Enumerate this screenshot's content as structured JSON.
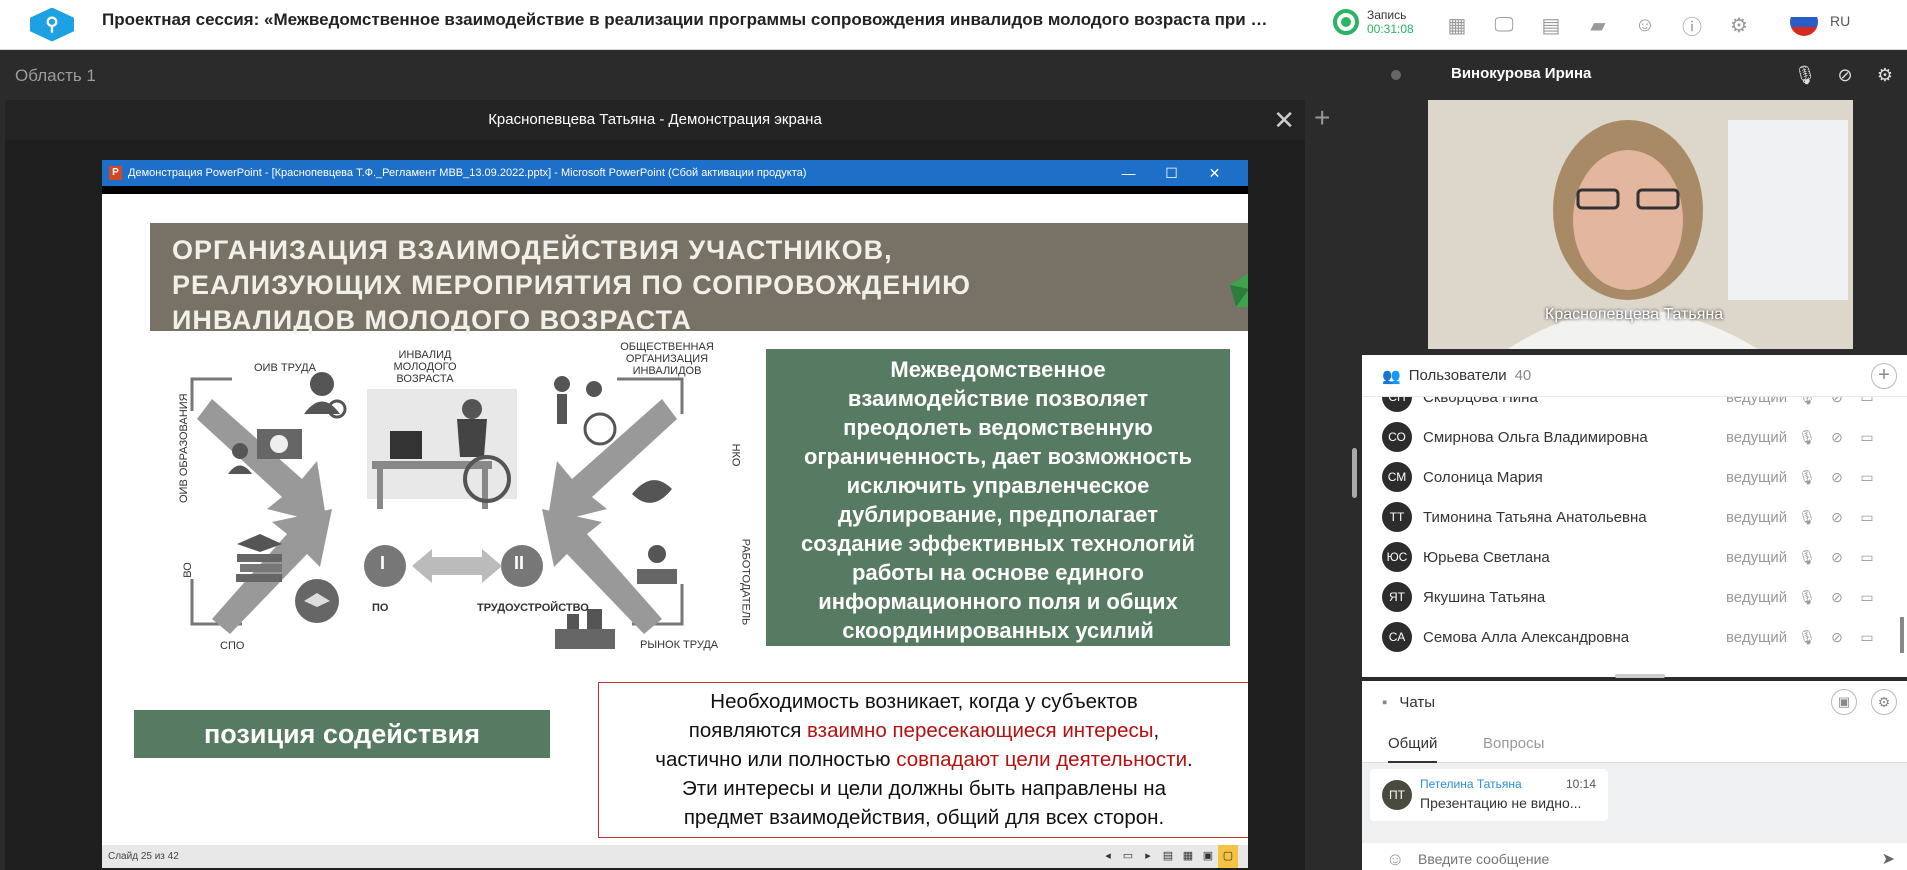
{
  "header": {
    "logo_glyph": "⚲",
    "title": "Проектная сессия: «Межведомственное взаимодействие в реализации программы сопровождения инвалидов молодого возраста при получ...",
    "record_label": "Запись",
    "record_time": "00:31:08",
    "icons": [
      "grid-icon",
      "monitor-icon",
      "document-icon",
      "folder-icon",
      "users-icon",
      "info-icon",
      "gear-icon"
    ],
    "lang": "RU"
  },
  "area": {
    "title": "Область 1",
    "panel_title": "Краснопевцева Татьяна - Демонстрация экрана",
    "close": "✕",
    "add": "+"
  },
  "ppt": {
    "window_title": "Демонстрация PowerPoint - [Краснопевцева Т.Ф._Регламент МВВ_13.09.2022.pptx] - Microsoft PowerPoint (Сбой активации продукта)",
    "app_icon": "P",
    "min": "—",
    "max": "☐",
    "close": "✕",
    "status": "Слайд 25 из 42"
  },
  "slide": {
    "banner_lines": [
      "ОРГАНИЗАЦИЯ ВЗАИМОДЕЙСТВИЯ УЧАСТНИКОВ,",
      "РЕАЛИЗУЮЩИХ МЕРОПРИЯТИЯ ПО СОПРОВОЖДЕНИЮ",
      "ИНВАЛИДОВ МОЛОДОГО ВОЗРАСТА"
    ],
    "green_lines": [
      "Межведомственное",
      "взаимодействие позволяет",
      "преодолеть ведомственную",
      "ограниченность, дает возможность",
      "исключить управленческое",
      "дублирование, предполагает",
      "создание эффективных технологий",
      "работы на основе единого",
      "информационного поля и общих",
      "скоординированных усилий"
    ],
    "position": "позиция содействия",
    "red": {
      "l1": "Необходимость возникает, когда у субъектов",
      "l2a": "появляются ",
      "l2b": "взаимно пересекающиеся интересы",
      "l2c": ",",
      "l3a": "частично или полностью ",
      "l3b": "совпадают цели деятельности",
      "l3c": ".",
      "l4": "Эти интересы и цели должны быть направлены на",
      "l5": "предмет взаимодействия, общий для всех сторон."
    },
    "diagram": {
      "oiv_truda": "ОИВ ТРУДА",
      "oiv_obr": "ОИВ ОБРАЗОВАНИЯ",
      "invalid": "ИНВАЛИД МОЛОДОГО ВОЗРАСТА",
      "obsh": "ОБЩЕСТВЕННАЯ ОРГАНИЗАЦИЯ ИНВАЛИДОВ",
      "nko": "НКО",
      "vo": "ВО",
      "spo": "СПО",
      "rabotodatel": "РАБОТОДАТЕЛЬ",
      "rynok": "РЫНОК ТРУДА",
      "po": "ПО",
      "trud": "ТРУДОУСТРОЙСТВО",
      "one": "I",
      "two": "II"
    }
  },
  "video": {
    "name": "Винокурова Ирина",
    "caption": "Краснопевцева Татьяна"
  },
  "users": {
    "label": "Пользователи",
    "count": "40",
    "list": [
      {
        "initials": "СН",
        "name": "Скворцова Нина",
        "role": "ведущий"
      },
      {
        "initials": "СО",
        "name": "Смирнова Ольга Владимировна",
        "role": "ведущий"
      },
      {
        "initials": "СМ",
        "name": "Солоница Мария",
        "role": "ведущий"
      },
      {
        "initials": "ТТ",
        "name": "Тимонина Татьяна Анатольевна",
        "role": "ведущий"
      },
      {
        "initials": "ЮС",
        "name": "Юрьева Светлана",
        "role": "ведущий"
      },
      {
        "initials": "ЯТ",
        "name": "Якушина Татьяна",
        "role": "ведущий"
      },
      {
        "initials": "СА",
        "name": "Семова Алла Александровна",
        "role": "ведущий"
      }
    ]
  },
  "chats": {
    "label": "Чаты",
    "tab_general": "Общий",
    "tab_questions": "Вопросы",
    "message": {
      "initials": "ПТ",
      "author": "Петелина Татьяна",
      "time": "10:14",
      "text": "Презентацию не видно..."
    },
    "placeholder": "Введите сообщение"
  }
}
